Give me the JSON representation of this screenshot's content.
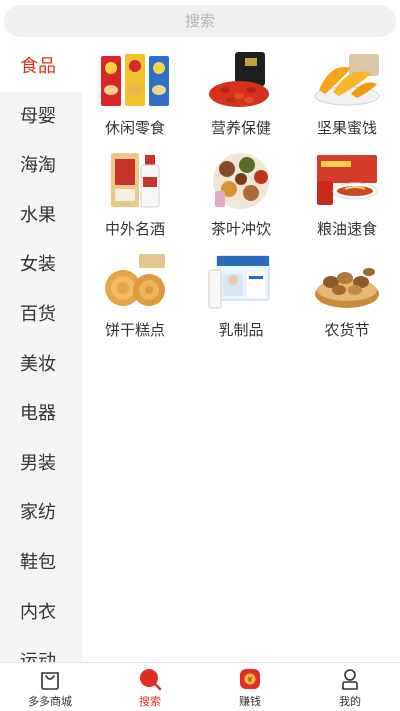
{
  "search": {
    "placeholder": "搜索"
  },
  "sidebar": {
    "items": [
      {
        "label": "食品"
      },
      {
        "label": "母婴"
      },
      {
        "label": "海淘"
      },
      {
        "label": "水果"
      },
      {
        "label": "女装"
      },
      {
        "label": "百货"
      },
      {
        "label": "美妆"
      },
      {
        "label": "电器"
      },
      {
        "label": "男装"
      },
      {
        "label": "家纺"
      },
      {
        "label": "鞋包"
      },
      {
        "label": "内衣"
      },
      {
        "label": "运动"
      }
    ],
    "active_label": "食品"
  },
  "categories": {
    "items": [
      {
        "label": "休闲零食",
        "icon": "chips-bags-icon"
      },
      {
        "label": "营养保健",
        "icon": "goji-berries-icon"
      },
      {
        "label": "坚果蜜饯",
        "icon": "dried-mango-icon"
      },
      {
        "label": "中外名酒",
        "icon": "liquor-bottle-icon"
      },
      {
        "label": "茶叶冲饮",
        "icon": "tea-mix-icon"
      },
      {
        "label": "粮油速食",
        "icon": "instant-noodles-icon"
      },
      {
        "label": "饼干糕点",
        "icon": "bread-rolls-icon"
      },
      {
        "label": "乳制品",
        "icon": "milk-box-icon"
      },
      {
        "label": "农货节",
        "icon": "nuts-bowl-icon"
      }
    ]
  },
  "tabbar": {
    "items": [
      {
        "label": "多多商城",
        "icon": "shopping-bag-icon"
      },
      {
        "label": "搜索",
        "icon": "search-icon"
      },
      {
        "label": "赚钱",
        "icon": "money-icon"
      },
      {
        "label": "我的",
        "icon": "profile-icon"
      }
    ],
    "active_label": "搜索"
  },
  "colors": {
    "accent": "#e02e24",
    "sidebar_bg": "#f5f5f5",
    "search_bg": "#f0f0f0"
  }
}
